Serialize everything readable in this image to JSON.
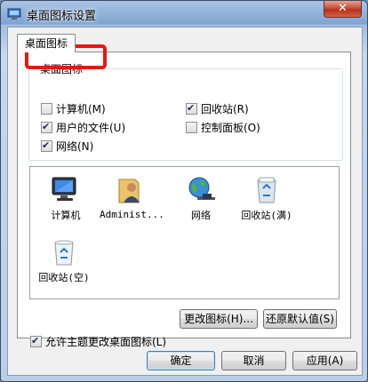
{
  "window": {
    "title": "桌面图标设置",
    "close_label": "✕"
  },
  "tabs": [
    {
      "label": "桌面图标"
    }
  ],
  "group": {
    "title": "桌面图标",
    "checkboxes": [
      {
        "label": "计算机(M)",
        "checked": false
      },
      {
        "label": "回收站(R)",
        "checked": true
      },
      {
        "label": "用户的文件(U)",
        "checked": true
      },
      {
        "label": "控制面板(O)",
        "checked": false
      },
      {
        "label": "网络(N)",
        "checked": true
      }
    ]
  },
  "icons": [
    {
      "label": "计算机",
      "icon": "computer-icon"
    },
    {
      "label": "Administ...",
      "icon": "user-folder-icon"
    },
    {
      "label": "网络",
      "icon": "network-globe-icon"
    },
    {
      "label": "回收站(满)",
      "icon": "recycle-bin-full-icon"
    },
    {
      "label": "回收站(空)",
      "icon": "recycle-bin-empty-icon"
    }
  ],
  "buttons": {
    "change_icon": "更改图标(H)...",
    "restore_default": "还原默认值(S)",
    "ok": "确定",
    "cancel": "取消",
    "apply": "应用(A)"
  },
  "allow_themes": {
    "label": "允许主题更改桌面图标(L)",
    "checked": true
  }
}
